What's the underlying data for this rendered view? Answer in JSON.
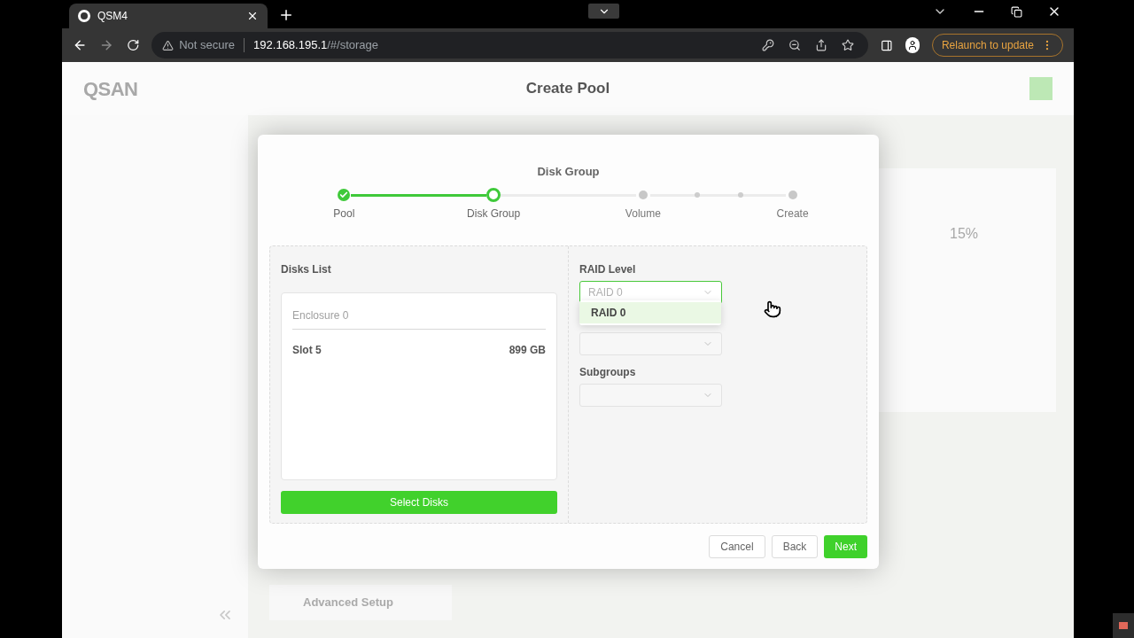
{
  "browser": {
    "tab": {
      "title": "QSM4"
    },
    "address": {
      "security": "Not secure",
      "host": "192.168.195.1",
      "path": "/#/storage"
    },
    "update_button": "Relaunch to update"
  },
  "app": {
    "logo": "QSAN",
    "page_title": "Create Pool",
    "usage": "15%",
    "advanced_setup": "Advanced Setup"
  },
  "dialog": {
    "heading": "Disk Group",
    "steps": [
      {
        "label": "Pool",
        "completed": true,
        "current": false
      },
      {
        "label": "Disk Group",
        "completed": false,
        "current": true
      },
      {
        "label": "Volume",
        "completed": false,
        "current": false
      },
      {
        "label": "Create",
        "completed": false,
        "current": false
      }
    ],
    "disks_list": {
      "title": "Disks List",
      "enclosure": "Enclosure 0",
      "disks": [
        {
          "slot": "Slot 5",
          "size": "899 GB"
        }
      ],
      "button": "Select Disks"
    },
    "fields": [
      {
        "label": "RAID Level",
        "value": "RAID 0",
        "focused": true
      },
      {
        "focused": false
      },
      {
        "label": "Subgroups",
        "focused": false
      }
    ],
    "dropdown": {
      "options": [
        {
          "label": "RAID 0",
          "selected": true
        }
      ]
    },
    "buttons": [
      {
        "label": "Cancel",
        "kind": "secondary"
      },
      {
        "label": "Back",
        "kind": "secondary"
      },
      {
        "label": "Next",
        "kind": "primary"
      }
    ]
  }
}
